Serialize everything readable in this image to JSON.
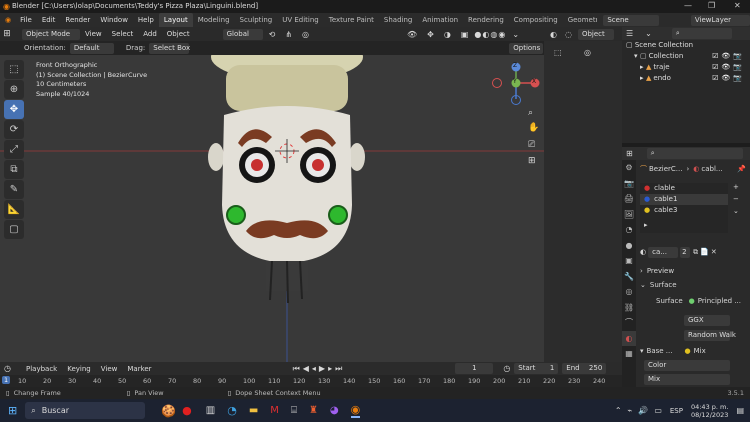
{
  "titlebar": {
    "title": "Blender [C:\\Users\\lolap\\Documents\\Teddy's Pizza Plaza\\Linguini.blend]"
  },
  "menu": [
    "File",
    "Edit",
    "Render",
    "Window",
    "Help"
  ],
  "workspaces": [
    "Layout",
    "Modeling",
    "Sculpting",
    "UV Editing",
    "Texture Paint",
    "Shading",
    "Animation",
    "Rendering",
    "Compositing",
    "Geometry Noc"
  ],
  "scene": {
    "scene_name": "Scene",
    "view_layer": "ViewLayer"
  },
  "viewport_header": {
    "mode": "Object Mode",
    "menus": [
      "View",
      "Select",
      "Add",
      "Object"
    ],
    "transform": "Global",
    "shading_mode": "Object"
  },
  "viewport_tool": {
    "orientation_label": "Orientation:",
    "orientation_value": "Default",
    "drag_label": "Drag:",
    "drag_value": "Select Box",
    "options": "Options"
  },
  "viewport_info": [
    "Front Orthographic",
    "(1) Scene Collection | BezierCurve",
    "10 Centimeters",
    "Sample 40/1024"
  ],
  "gizmo": {
    "x": "X",
    "y": "Y",
    "z": "Z"
  },
  "outliner": {
    "root": "Scene Collection",
    "items": [
      "Collection",
      "traje",
      "endo"
    ]
  },
  "properties": {
    "object_name": "BezierC...",
    "data_name": "cabl...",
    "materials": [
      "clable",
      "cable1",
      "cable3"
    ],
    "material_slot": "ca...",
    "user_count": "2",
    "preview": "Preview",
    "surface_section": "Surface",
    "surface_label": "Surface",
    "surface_value": "Principled ...",
    "distribution": "GGX",
    "subsurface": "Random Walk",
    "base_label": "Base ...",
    "base_value": "Mix",
    "color_label": "Color",
    "mix_label": "Mix"
  },
  "timeline": {
    "menus": [
      "Playback",
      "Keying",
      "View",
      "Marker"
    ],
    "current_frame": "1",
    "start_label": "Start",
    "start": "1",
    "end_label": "End",
    "end": "250",
    "ticks": [
      "10",
      "20",
      "30",
      "40",
      "50",
      "60",
      "70",
      "80",
      "90",
      "100",
      "110",
      "120",
      "130",
      "140",
      "150",
      "160",
      "170",
      "180",
      "190",
      "200",
      "210",
      "220",
      "230",
      "240"
    ]
  },
  "statusbar": {
    "left": "Change Frame",
    "mid1": "Pan View",
    "mid2": "Dope Sheet Context Menu",
    "version": "3.5.1"
  },
  "taskbar": {
    "search": "Buscar",
    "lang": "ESP",
    "time": "04:43 p. m.",
    "date": "08/12/2023"
  },
  "colors": {
    "accent": "#4772b3",
    "material_red": "#d03030",
    "material_blue": "#2a5ad0",
    "material_yellow": "#e0c020"
  }
}
